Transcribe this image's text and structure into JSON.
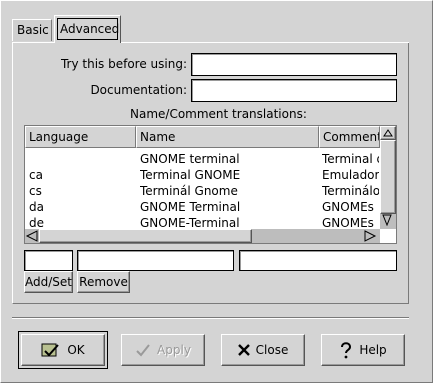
{
  "tabs": [
    {
      "label": "Basic"
    },
    {
      "label": "Advanced"
    }
  ],
  "form": {
    "try_label": "Try this before using:",
    "try_value": "",
    "doc_label": "Documentation:",
    "doc_value": "",
    "translations_label": "Name/Comment translations:"
  },
  "table": {
    "headers": [
      "Language",
      "Name",
      "Comment"
    ],
    "rows": [
      [
        "",
        "GNOME terminal",
        "Terminal d"
      ],
      [
        "ca",
        "Terminal GNOME",
        "Emulador"
      ],
      [
        "cs",
        "Terminál Gnome",
        "Terminálo"
      ],
      [
        "da",
        "GNOME Terminal",
        "GNOMEs"
      ],
      [
        "de",
        "GNOME-Terminal",
        "GNOMEs"
      ]
    ]
  },
  "edit": {
    "lang_value": "",
    "name_value": "",
    "comment_value": "",
    "add_set_label": "Add/Set",
    "remove_label": "Remove"
  },
  "buttons": {
    "ok": "OK",
    "apply": "Apply",
    "close": "Close",
    "help": "Help"
  }
}
